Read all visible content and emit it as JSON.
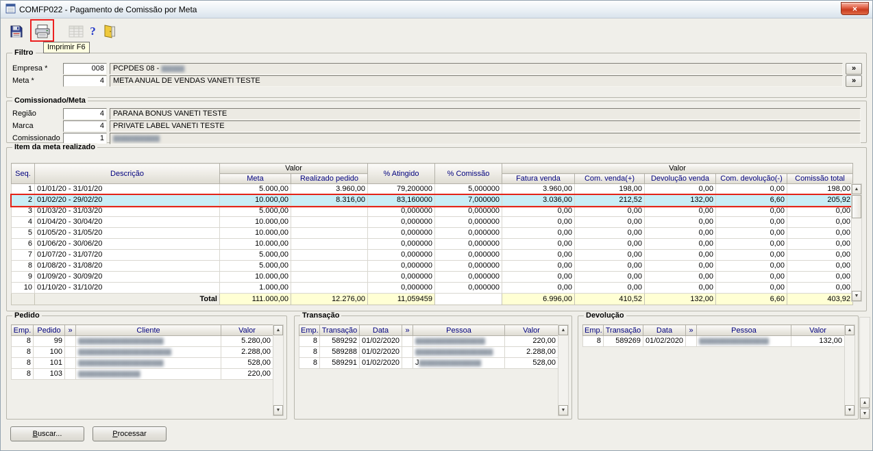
{
  "window": {
    "title": "COMFP022 - Pagamento de Comissão por Meta",
    "close_glyph": "×"
  },
  "chrome": {
    "more_glyph": "»",
    "up_glyph": "▲",
    "down_glyph": "▼",
    "help_glyph": "?"
  },
  "toolbar": {
    "tooltip": "Imprimir F6",
    "icons": [
      "save-icon",
      "printer-icon",
      "grid-icon",
      "help-icon",
      "exit-door-icon"
    ]
  },
  "filtro": {
    "title": "Filtro",
    "rows": [
      {
        "label": "Empresa *",
        "code": "008",
        "desc": "PCPDES 08 - ",
        "desc_redacted": "██████",
        "more": "»"
      },
      {
        "label": "Meta *",
        "code": "4",
        "desc": "META ANUAL DE VENDAS VANETI TESTE",
        "desc_redacted": "",
        "more": "»"
      }
    ]
  },
  "comissionado": {
    "title": "Comissionado/Meta",
    "rows": [
      {
        "label": "Região",
        "code": "4",
        "desc": "PARANA BONUS VANETI TESTE",
        "desc_redacted": ""
      },
      {
        "label": "Marca",
        "code": "4",
        "desc": "PRIVATE LABEL VANETI TESTE",
        "desc_redacted": ""
      },
      {
        "label": "Comissionado",
        "code": "1",
        "desc": "",
        "desc_redacted": "████████████"
      }
    ]
  },
  "meta_grid": {
    "title": "Item da meta realizado",
    "headers": {
      "seq": "Seq.",
      "descricao": "Descrição",
      "valor": "Valor",
      "meta": "Meta",
      "realizado": "Realizado pedido",
      "atingido": "% Atingido",
      "comissao": "% Comissão",
      "valor2": "Valor",
      "fatura": "Fatura venda",
      "com_venda": "Com. venda(+)",
      "devolucao_venda": "Devolução venda",
      "com_devolucao": "Com. devolução(-)",
      "comissao_total": "Comissão total"
    },
    "rows": [
      {
        "seq": "1",
        "desc": "01/01/20 - 31/01/20",
        "meta": "5.000,00",
        "realizado": "3.960,00",
        "atingido": "79,200000",
        "comissao": "5,000000",
        "fatura": "3.960,00",
        "com_venda": "198,00",
        "devolucao_venda": "0,00",
        "com_devolucao": "0,00",
        "comissao_total": "198,00",
        "selected": false
      },
      {
        "seq": "2",
        "desc": "01/02/20 - 29/02/20",
        "meta": "10.000,00",
        "realizado": "8.316,00",
        "atingido": "83,160000",
        "comissao": "7,000000",
        "fatura": "3.036,00",
        "com_venda": "212,52",
        "devolucao_venda": "132,00",
        "com_devolucao": "6,60",
        "comissao_total": "205,92",
        "selected": true
      },
      {
        "seq": "3",
        "desc": "01/03/20 - 31/03/20",
        "meta": "5.000,00",
        "realizado": "",
        "atingido": "0,000000",
        "comissao": "0,000000",
        "fatura": "0,00",
        "com_venda": "0,00",
        "devolucao_venda": "0,00",
        "com_devolucao": "0,00",
        "comissao_total": "0,00",
        "selected": false
      },
      {
        "seq": "4",
        "desc": "01/04/20 - 30/04/20",
        "meta": "10.000,00",
        "realizado": "",
        "atingido": "0,000000",
        "comissao": "0,000000",
        "fatura": "0,00",
        "com_venda": "0,00",
        "devolucao_venda": "0,00",
        "com_devolucao": "0,00",
        "comissao_total": "0,00",
        "selected": false
      },
      {
        "seq": "5",
        "desc": "01/05/20 - 31/05/20",
        "meta": "10.000,00",
        "realizado": "",
        "atingido": "0,000000",
        "comissao": "0,000000",
        "fatura": "0,00",
        "com_venda": "0,00",
        "devolucao_venda": "0,00",
        "com_devolucao": "0,00",
        "comissao_total": "0,00",
        "selected": false
      },
      {
        "seq": "6",
        "desc": "01/06/20 - 30/06/20",
        "meta": "10.000,00",
        "realizado": "",
        "atingido": "0,000000",
        "comissao": "0,000000",
        "fatura": "0,00",
        "com_venda": "0,00",
        "devolucao_venda": "0,00",
        "com_devolucao": "0,00",
        "comissao_total": "0,00",
        "selected": false
      },
      {
        "seq": "7",
        "desc": "01/07/20 - 31/07/20",
        "meta": "5.000,00",
        "realizado": "",
        "atingido": "0,000000",
        "comissao": "0,000000",
        "fatura": "0,00",
        "com_venda": "0,00",
        "devolucao_venda": "0,00",
        "com_devolucao": "0,00",
        "comissao_total": "0,00",
        "selected": false
      },
      {
        "seq": "8",
        "desc": "01/08/20 - 31/08/20",
        "meta": "5.000,00",
        "realizado": "",
        "atingido": "0,000000",
        "comissao": "0,000000",
        "fatura": "0,00",
        "com_venda": "0,00",
        "devolucao_venda": "0,00",
        "com_devolucao": "0,00",
        "comissao_total": "0,00",
        "selected": false
      },
      {
        "seq": "9",
        "desc": "01/09/20 - 30/09/20",
        "meta": "10.000,00",
        "realizado": "",
        "atingido": "0,000000",
        "comissao": "0,000000",
        "fatura": "0,00",
        "com_venda": "0,00",
        "devolucao_venda": "0,00",
        "com_devolucao": "0,00",
        "comissao_total": "0,00",
        "selected": false
      },
      {
        "seq": "10",
        "desc": "01/10/20 - 31/10/20",
        "meta": "1.000,00",
        "realizado": "",
        "atingido": "0,000000",
        "comissao": "0,000000",
        "fatura": "0,00",
        "com_venda": "0,00",
        "devolucao_venda": "0,00",
        "com_devolucao": "0,00",
        "comissao_total": "0,00",
        "selected": false
      }
    ],
    "total": {
      "label": "Total",
      "meta": "111.000,00",
      "realizado": "12.276,00",
      "atingido": "11,059459",
      "comissao": "",
      "fatura": "6.996,00",
      "com_venda": "410,52",
      "devolucao_venda": "132,00",
      "com_devolucao": "6,60",
      "comissao_total": "403,92"
    }
  },
  "pedido": {
    "title": "Pedido",
    "headers": {
      "emp": "Emp.",
      "pedido": "Pedido",
      "more": "»",
      "cliente": "Cliente",
      "valor": "Valor"
    },
    "rows": [
      {
        "emp": "8",
        "pedido": "99",
        "cliente_redacted": "██████████████████████",
        "valor": "5.280,00"
      },
      {
        "emp": "8",
        "pedido": "100",
        "cliente_redacted": "████████████████████████",
        "valor": "2.288,00"
      },
      {
        "emp": "8",
        "pedido": "101",
        "cliente_redacted": "██████████████████████",
        "valor": "528,00"
      },
      {
        "emp": "8",
        "pedido": "103",
        "cliente_redacted": "████████████████",
        "valor": "220,00"
      }
    ]
  },
  "transacao": {
    "title": "Transação",
    "headers": {
      "emp": "Emp.",
      "transacao": "Transação",
      "data": "Data",
      "more": "»",
      "pessoa": "Pessoa",
      "valor": "Valor"
    },
    "rows": [
      {
        "emp": "8",
        "transacao": "589292",
        "data": "01/02/2020",
        "pessoa_prefix": "",
        "pessoa_redacted": "██████████████████",
        "valor": "220,00"
      },
      {
        "emp": "8",
        "transacao": "589288",
        "data": "01/02/2020",
        "pessoa_prefix": "",
        "pessoa_redacted": "████████████████████",
        "valor": "2.288,00"
      },
      {
        "emp": "8",
        "transacao": "589291",
        "data": "01/02/2020",
        "pessoa_prefix": "J",
        "pessoa_redacted": "████████████████",
        "valor": "528,00"
      }
    ]
  },
  "devolucao": {
    "title": "Devolução",
    "headers": {
      "emp": "Emp.",
      "transacao": "Transação",
      "data": "Data",
      "more": "»",
      "pessoa": "Pessoa",
      "valor": "Valor"
    },
    "rows": [
      {
        "emp": "8",
        "transacao": "589269",
        "data": "01/02/2020",
        "pessoa_prefix": "",
        "pessoa_redacted": "██████████████████",
        "valor": "132,00"
      }
    ]
  },
  "footer": {
    "buscar_key": "B",
    "buscar_rest": "uscar...",
    "processar_key": "P",
    "processar_rest": "rocessar"
  },
  "colors": {
    "selection_row": "#C9EEF6",
    "total_row": "#FFFFD4",
    "annotation_red": "#EC1F1F",
    "header_text": "#00007E",
    "tooltip_bg": "#FFFFE1",
    "window_bg": "#F0EFEA"
  }
}
